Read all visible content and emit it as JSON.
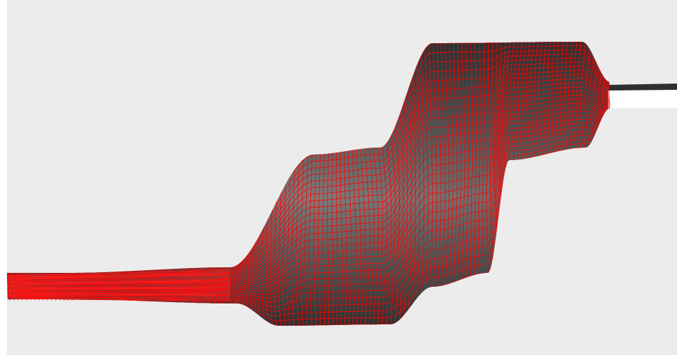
{
  "scene": {
    "background_color": "#ececec",
    "left_strip_color": "#ffffff",
    "surface_dark_color": "#2f2f2f",
    "surface_mid_color": "#555555",
    "surface_light_color": "#7d7d7d",
    "hole_color": "#ffffff",
    "mesh_color": "#ff0000",
    "mesh_dense_color": "#ff1a1a",
    "object": "red-wireframe-mesh-over-shaded-surface"
  }
}
